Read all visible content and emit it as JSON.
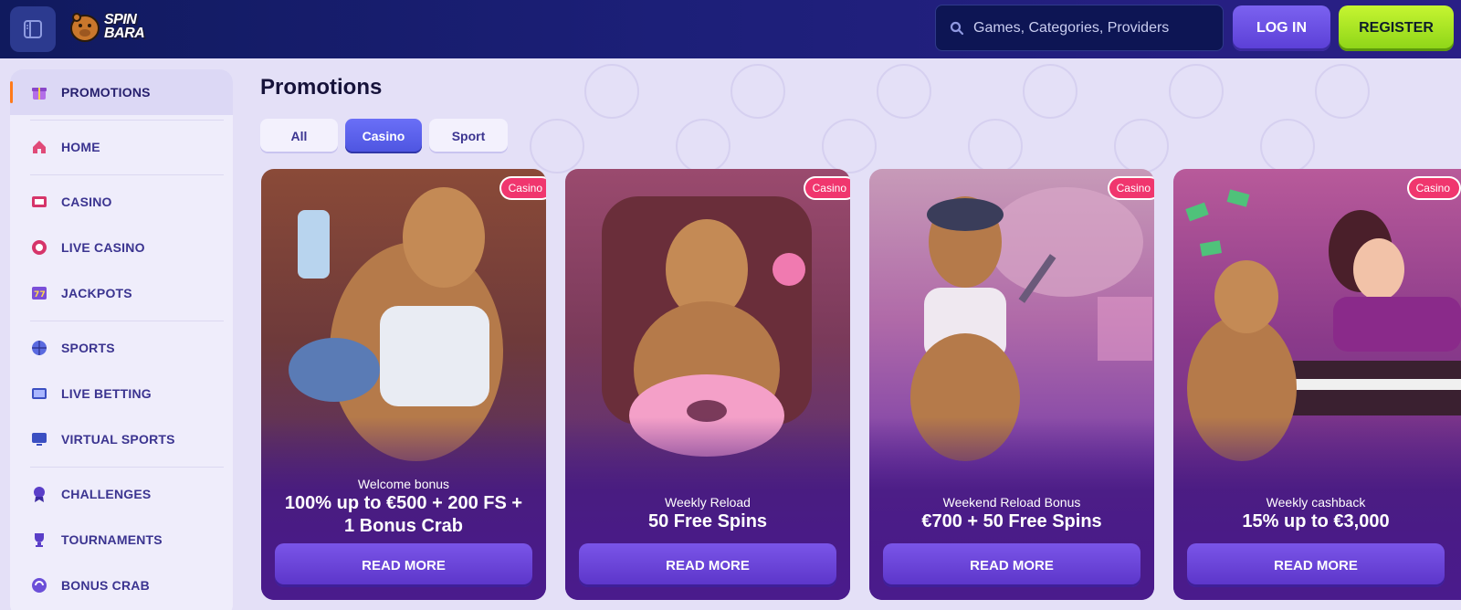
{
  "header": {
    "logo_line1": "SPIN",
    "logo_line2": "BARA",
    "search_placeholder": "Games, Categories, Providers",
    "login_label": "LOG IN",
    "register_label": "REGISTER"
  },
  "sidebar": {
    "items": [
      {
        "label": "PROMOTIONS",
        "icon": "gift-icon"
      },
      {
        "label": "HOME",
        "icon": "home-icon"
      },
      {
        "label": "CASINO",
        "icon": "casino-icon"
      },
      {
        "label": "LIVE CASINO",
        "icon": "chip-icon"
      },
      {
        "label": "JACKPOTS",
        "icon": "slot-777-icon"
      },
      {
        "label": "SPORTS",
        "icon": "basketball-icon"
      },
      {
        "label": "LIVE BETTING",
        "icon": "live-tv-icon"
      },
      {
        "label": "VIRTUAL SPORTS",
        "icon": "monitor-icon"
      },
      {
        "label": "CHALLENGES",
        "icon": "medal-icon"
      },
      {
        "label": "TOURNAMENTS",
        "icon": "trophy-icon"
      },
      {
        "label": "BONUS CRAB",
        "icon": "crab-icon"
      }
    ]
  },
  "main": {
    "title": "Promotions",
    "tabs": [
      {
        "label": "All"
      },
      {
        "label": "Casino"
      },
      {
        "label": "Sport"
      }
    ],
    "cards": [
      {
        "badge": "Casino",
        "subtitle": "Welcome bonus",
        "title_line1": "100% up to €500 + 200 FS +",
        "title_line2": "1 Bonus Crab",
        "button": "READ MORE"
      },
      {
        "badge": "Casino",
        "subtitle": "Weekly Reload",
        "title_line1": "50 Free Spins",
        "title_line2": "",
        "button": "READ MORE"
      },
      {
        "badge": "Casino",
        "subtitle": "Weekend Reload Bonus",
        "title_line1": "€700 + 50 Free Spins",
        "title_line2": "",
        "button": "READ MORE"
      },
      {
        "badge": "Casino",
        "subtitle": "Weekly cashback",
        "title_line1": "15% up to €3,000",
        "title_line2": "",
        "button": "READ MORE"
      }
    ]
  },
  "colors": {
    "header_bg": "#1c1f78",
    "accent": "#5b34c8",
    "register": "#a6e32a",
    "badge": "#f0366e",
    "active_marker": "#ff7a1a"
  }
}
